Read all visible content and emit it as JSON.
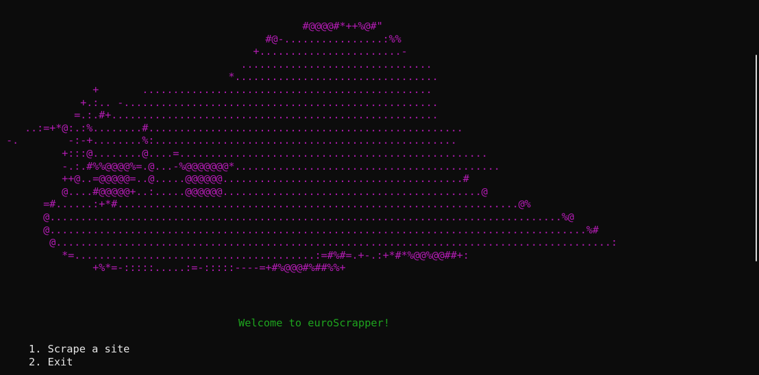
{
  "terminal": {
    "background": "#0c0c0c",
    "art_color": "#b41cb4",
    "welcome_color": "#1ea51e",
    "menu_color": "#e6e6e6"
  },
  "ascii_art": {
    "lines": [
      "                                                 #@@@@#*++%@#\"",
      "                                           #@-................:%%",
      "                                         +.......................-",
      "                                       ...............................",
      "                                     *.................................",
      "               +       ...............................................",
      "             +.:.. -...................................................",
      "            =.:.#+.....................................................",
      "    ..:=+*@:.:%........#...................................................",
      " -.        -:-+........%:.................................................",
      "          +:::@........@....=..................................................",
      "          -.:.#%%@@@@%=.@...-%@@@@@@@*...........................................",
      "          ++@..=@@@@@=..@.....@@@@@@.......................................#",
      "          @....#@@@@@+..:.....@@@@@@..........................................@",
      "       =#......:+*#.................................................................@%",
      "       @...................................................................................%@",
      "       @.......................................................................................%#",
      "        @..........................................................................................:",
      "          *=.......................................:=#%#=.+-.:+*#*%@@%@@##+:",
      "               +%*=-:::::.....:=-:::::----=+#%@@@#%##%%+"
    ]
  },
  "welcome": {
    "text": "Welcome to euroScrapper!"
  },
  "menu": {
    "items": [
      {
        "number": "1.",
        "label": "Scrape a site"
      },
      {
        "number": "2.",
        "label": "Exit"
      }
    ]
  }
}
